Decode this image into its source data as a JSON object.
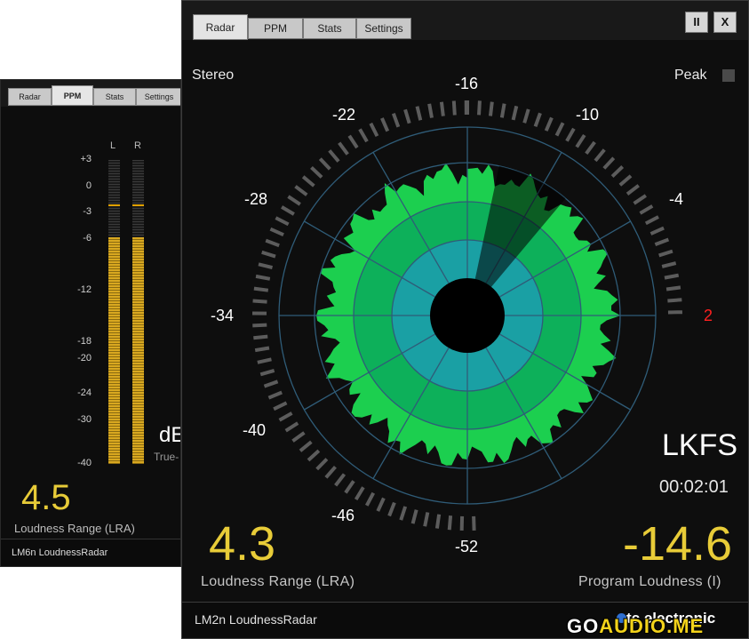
{
  "back_window": {
    "tabs": [
      "Radar",
      "PPM",
      "Stats",
      "Settings"
    ],
    "active_tab": "PPM",
    "channels": [
      "L",
      "R"
    ],
    "scale": [
      "+3",
      "0",
      "-3",
      "-6",
      "-12",
      "-18",
      "-20",
      "-24",
      "-30",
      "-40"
    ],
    "meter_level_db": [
      -6,
      -6
    ],
    "peak_hold_db": [
      -2.5,
      -2.5
    ],
    "lra_value": "4.5",
    "lra_label": "Loudness Range (LRA)",
    "unit_partial": "dE",
    "truepeak_partial": "True-",
    "brand": "LM6n LoudnessRadar"
  },
  "main_window": {
    "tabs": [
      "Radar",
      "PPM",
      "Stats",
      "Settings"
    ],
    "active_tab": "Radar",
    "pause_btn": "II",
    "close_btn": "X",
    "stereo_label": "Stereo",
    "peak_label": "Peak",
    "radar_labels": [
      "-16",
      "-10",
      "-4",
      "2",
      "-52",
      "-46",
      "-40",
      "-34",
      "-28",
      "-22"
    ],
    "unit": "LKFS",
    "time": "00:02:01",
    "lra_value": "4.3",
    "lra_label": "Loudness Range (LRA)",
    "program_value": "-14.6",
    "program_label": "Program Loudness (I)",
    "brand_name": "LM2n LoudnessRadar",
    "vendor": "tc electronic"
  },
  "watermark": {
    "prefix": "GO",
    "suffix": "AUDIO.ME"
  },
  "colors": {
    "yellow": "#e8cc38",
    "radar_green": "#1de055",
    "radar_teal": "#12a3a3",
    "alert_red": "#ff2020"
  }
}
